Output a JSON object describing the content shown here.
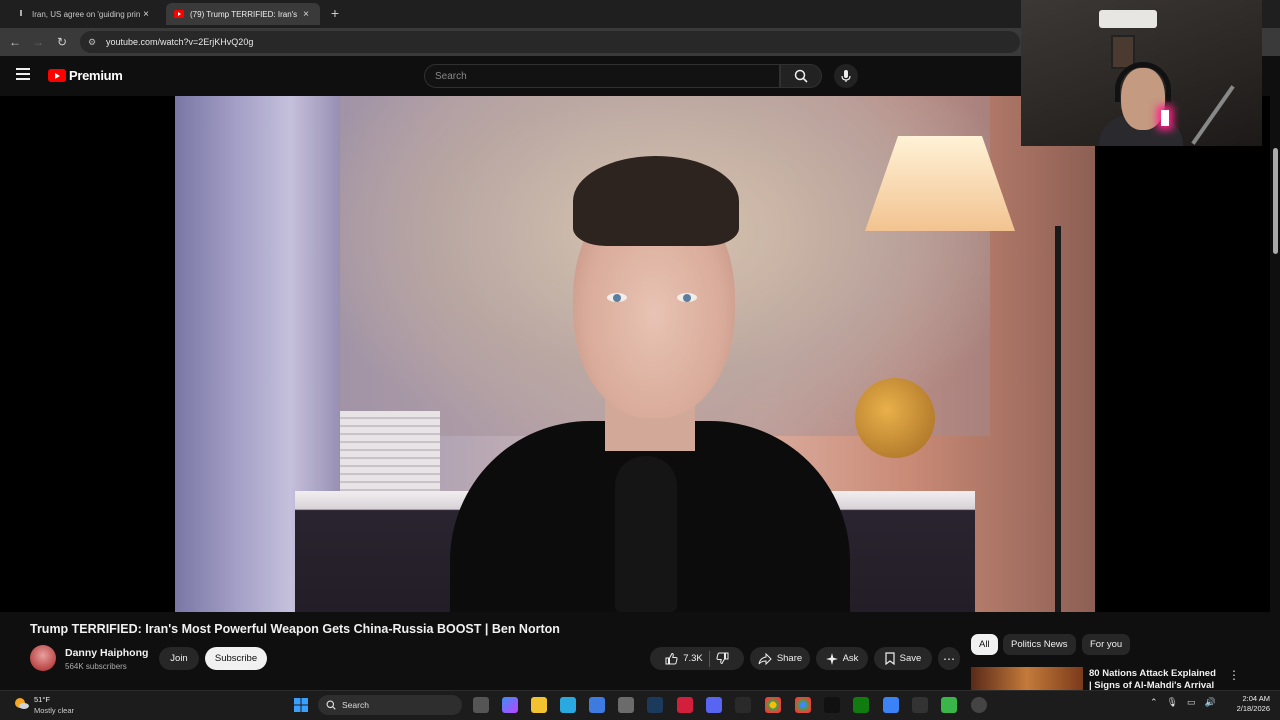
{
  "browser": {
    "tabs": [
      {
        "title": "Iran, US agree on 'guiding prin",
        "favicon": "news-icon"
      },
      {
        "title": "(79) Trump TERRIFIED: Iran's M",
        "favicon": "youtube-icon"
      }
    ],
    "new_tab": "+",
    "url": "youtube.com/watch?v=2ErjKHvQ20g"
  },
  "youtube": {
    "logo_text": "Premium",
    "search_placeholder": "Search"
  },
  "video": {
    "title": "Trump TERRIFIED: Iran's Most Powerful Weapon Gets China-Russia BOOST | Ben Norton",
    "channel": "Danny Haiphong",
    "subscribers": "564K subscribers",
    "join_label": "Join",
    "subscribe_label": "Subscribe",
    "likes": "7.3K",
    "share_label": "Share",
    "ask_label": "Ask",
    "save_label": "Save"
  },
  "sidebar": {
    "chips": [
      "All",
      "Politics News",
      "For you"
    ],
    "recommended_title": "80 Nations Attack Explained | Signs of Al-Mahdi's Arrival"
  },
  "taskbar": {
    "temperature": "51°F",
    "weather": "Mostly clear",
    "search_label": "Search",
    "time": "2:04 AM",
    "date": "2/18/2026"
  },
  "colors": {
    "brand_red": "#ff0000",
    "background": "#0f0f0f",
    "pill_bg": "#272727"
  }
}
